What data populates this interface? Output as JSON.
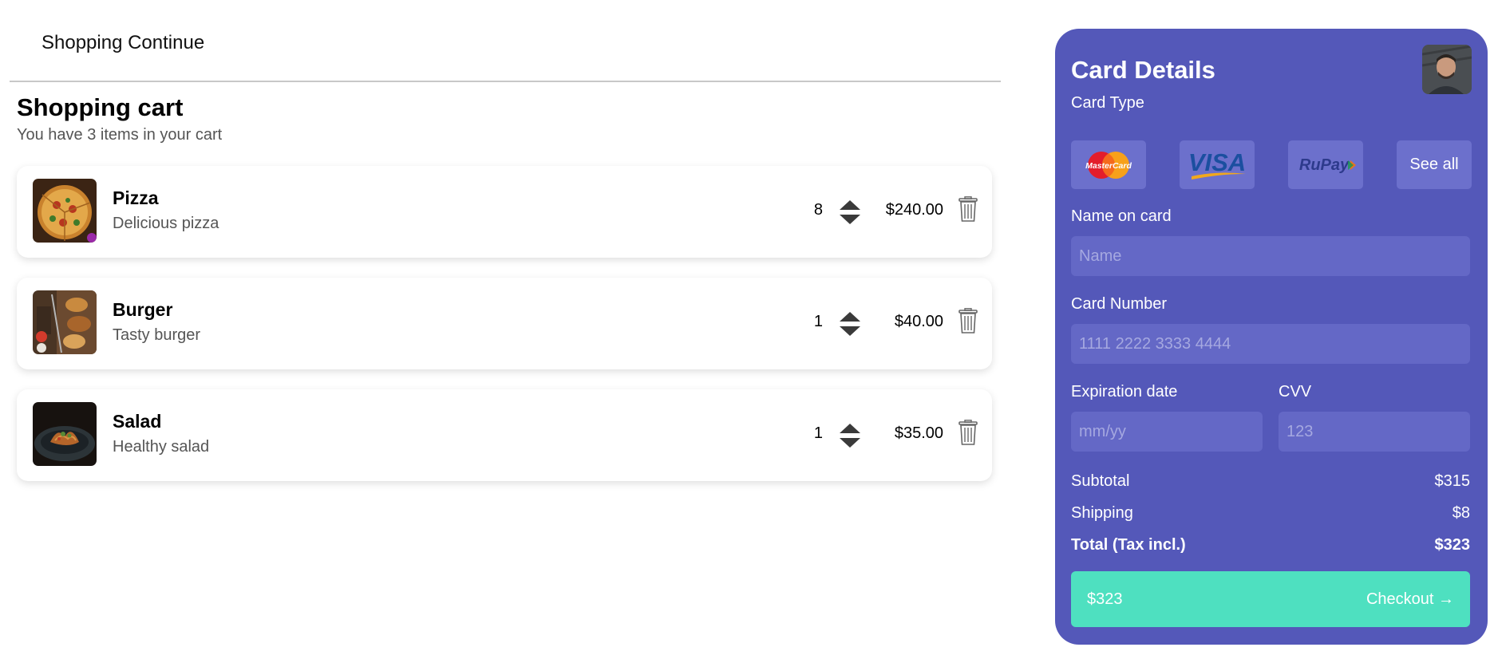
{
  "header": {
    "continue_label": "Shopping Continue"
  },
  "cart": {
    "title": "Shopping cart",
    "subtitle": "You have 3 items in your cart",
    "items": [
      {
        "name": "Pizza",
        "description": "Delicious pizza",
        "quantity": "8",
        "price": "$240.00",
        "image": "pizza-image"
      },
      {
        "name": "Burger",
        "description": "Tasty burger",
        "quantity": "1",
        "price": "$40.00",
        "image": "burger-image"
      },
      {
        "name": "Salad",
        "description": "Healthy salad",
        "quantity": "1",
        "price": "$35.00",
        "image": "salad-image"
      }
    ]
  },
  "payment": {
    "title": "Card Details",
    "card_type_label": "Card Type",
    "card_types": [
      "MasterCard",
      "VISA",
      "RuPay"
    ],
    "see_all_label": "See all",
    "name_label": "Name on card",
    "name_placeholder": "Name",
    "number_label": "Card Number",
    "number_placeholder": "1111 2222 3333 4444",
    "expiry_label": "Expiration date",
    "expiry_placeholder": "mm/yy",
    "cvv_label": "CVV",
    "cvv_placeholder": "123",
    "subtotal_label": "Subtotal",
    "subtotal_value": "$315",
    "shipping_label": "Shipping",
    "shipping_value": "$8",
    "total_label": "Total (Tax incl.)",
    "total_value": "$323",
    "checkout_amount": "$323",
    "checkout_label": "Checkout →"
  },
  "colors": {
    "panel_bg": "#5458b9",
    "input_bg": "#6468c6",
    "checkout_bg": "#4ee0c0"
  },
  "icons": [
    "stepper-arrows-icon",
    "trash-icon",
    "mastercard-logo",
    "visa-logo",
    "rupay-logo",
    "avatar"
  ]
}
